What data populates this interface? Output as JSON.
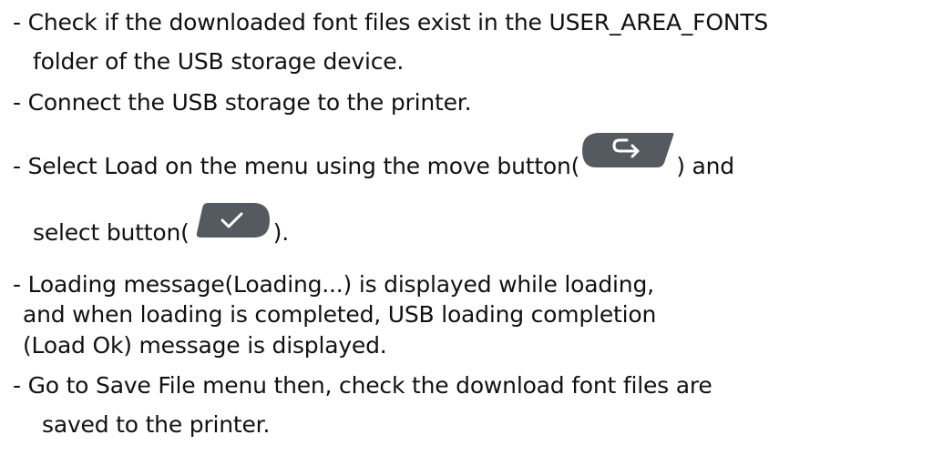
{
  "doc": {
    "line1": "- Check if the downloaded font files exist in the USER_AREA_FONTS",
    "line2": "folder of the USB storage device.",
    "line3": "- Connect the USB storage to the printer.",
    "line4_before": "- Select Load on the menu using the move button(",
    "line4_after": ") and",
    "line5_before": "select button(",
    "line5_after": ").",
    "line6": "- Loading message(Loading...) is displayed while loading,",
    "line7": "and when loading is completed, USB loading completion",
    "line8": "(Load Ok) message is displayed.",
    "line9": "- Go to Save File menu then, check the download font files are",
    "line10": "saved to the printer."
  },
  "icons": {
    "move_button": "move-arrow-icon",
    "select_button": "checkmark-icon",
    "button_color": "#555a60",
    "glyph_color": "#ffffff"
  }
}
